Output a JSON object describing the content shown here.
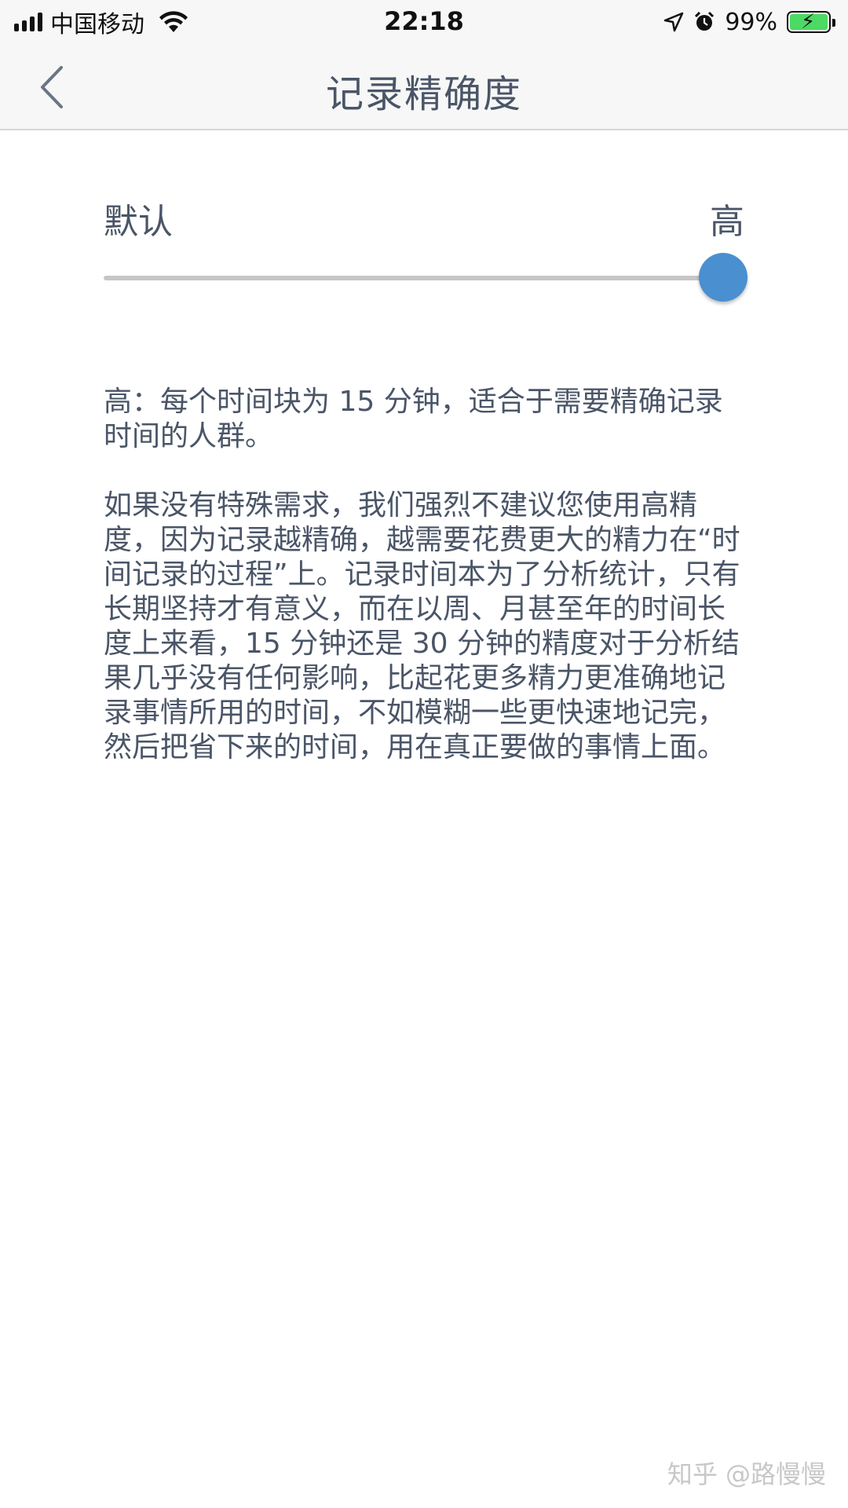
{
  "status_bar": {
    "carrier": "中国移动",
    "time": "22:18",
    "battery_percent": "99%",
    "battery_level": 0.99,
    "icons": [
      "signal-icon",
      "wifi-icon",
      "location-arrow-icon",
      "alarm-icon",
      "battery-charging-icon"
    ]
  },
  "nav": {
    "title": "记录精确度",
    "back_icon": "chevron-left-icon"
  },
  "slider": {
    "min_label": "默认",
    "max_label": "高",
    "value": 1.0,
    "accent_color": "#4a8fd0"
  },
  "description": {
    "paragraph1": "高：每个时间块为 15 分钟，适合于需要精确记录时间的人群。",
    "paragraph2": "如果没有特殊需求，我们强烈不建议您使用高精度，因为记录越精确，越需要花费更大的精力在“时间记录的过程”上。记录时间本为了分析统计，只有长期坚持才有意义，而在以周、月甚至年的时间长度上来看，15 分钟还是 30 分钟的精度对于分析结果几乎没有任何影响，比起花更多精力更准确地记录事情所用的时间，不如模糊一些更快速地记完，然后把省下来的时间，用在真正要做的事情上面。"
  },
  "watermark": "知乎 @路慢慢"
}
